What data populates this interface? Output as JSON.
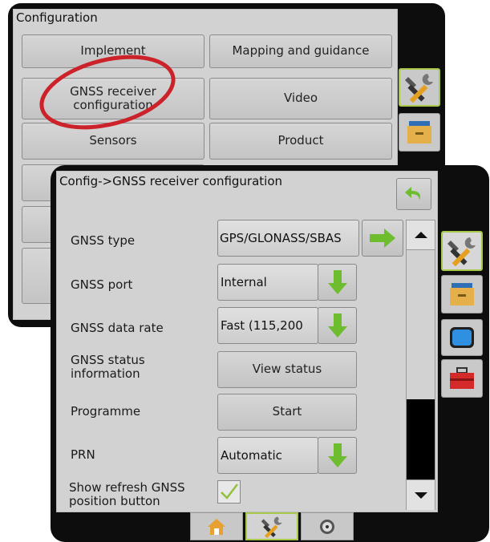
{
  "back_panel": {
    "title": "Configuration",
    "buttons": [
      "Implement",
      "Mapping and guidance",
      "GNSS receiver configuration",
      "Video",
      "Sensors",
      "Product"
    ]
  },
  "front_panel": {
    "title": "Config->GNSS receiver configuration",
    "rows": [
      {
        "label": "GNSS type",
        "value": "GPS/GLONASS/SBAS"
      },
      {
        "label": "GNSS port",
        "value": "Internal"
      },
      {
        "label": "GNSS data rate",
        "value": "Fast (115,200"
      },
      {
        "label": "GNSS status information",
        "value": "View status"
      },
      {
        "label": "Programme",
        "value": "Start"
      },
      {
        "label": "PRN",
        "value": "Automatic"
      },
      {
        "label": "Show refresh GNSS position button",
        "checked": true
      }
    ]
  },
  "colors": {
    "accent": "#a8c84a",
    "arrow_green": "#6dbd2e",
    "highlight": "#cc2229"
  },
  "icons": [
    "back-icon",
    "tools-icon",
    "files-icon",
    "screen-icon",
    "toolbox-icon",
    "home-icon",
    "speedometer-icon",
    "arrow-up-icon",
    "arrow-down-icon"
  ]
}
